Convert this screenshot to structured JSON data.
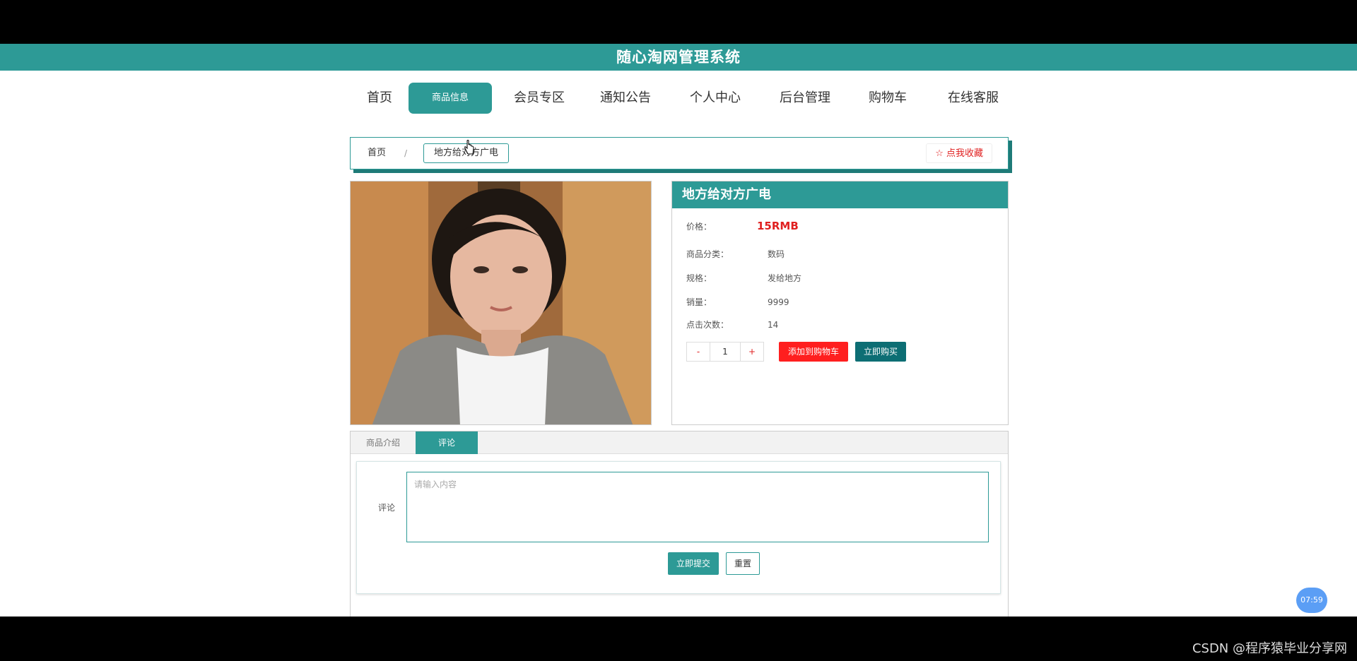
{
  "header": {
    "title": "随心淘网管理系统"
  },
  "nav": {
    "items": [
      "首页",
      "商品信息",
      "会员专区",
      "通知公告",
      "个人中心",
      "后台管理",
      "购物车",
      "在线客服"
    ]
  },
  "breadcrumb": {
    "home": "首页",
    "separator": "/",
    "current": "地方给对方广电",
    "favorite": "☆ 点我收藏"
  },
  "product": {
    "title": "地方给对方广电",
    "price_label": "价格：",
    "price": "15RMB",
    "category_label": "商品分类：",
    "category": "数码",
    "spec_label": "规格：",
    "spec": "发给地方",
    "sales_label": "销量：",
    "sales": "9999",
    "clicks_label": "点击次数：",
    "clicks": "14",
    "qty_minus": "-",
    "qty_value": "1",
    "qty_plus": "+",
    "add_to_cart": "添加到购物车",
    "buy_now": "立即购买"
  },
  "tabs": {
    "intro": "商品介绍",
    "comment": "评论"
  },
  "comment": {
    "label": "评论",
    "placeholder": "请输入内容",
    "submit": "立即提交",
    "reset": "重置"
  },
  "overlay": {
    "time": "07:59",
    "watermark": "CSDN @程序猿毕业分享网"
  },
  "colors": {
    "brand": "#2d9a96",
    "price": "#e02020",
    "cart_button": "#ff1f1f",
    "buy_button": "#0d6e74"
  }
}
